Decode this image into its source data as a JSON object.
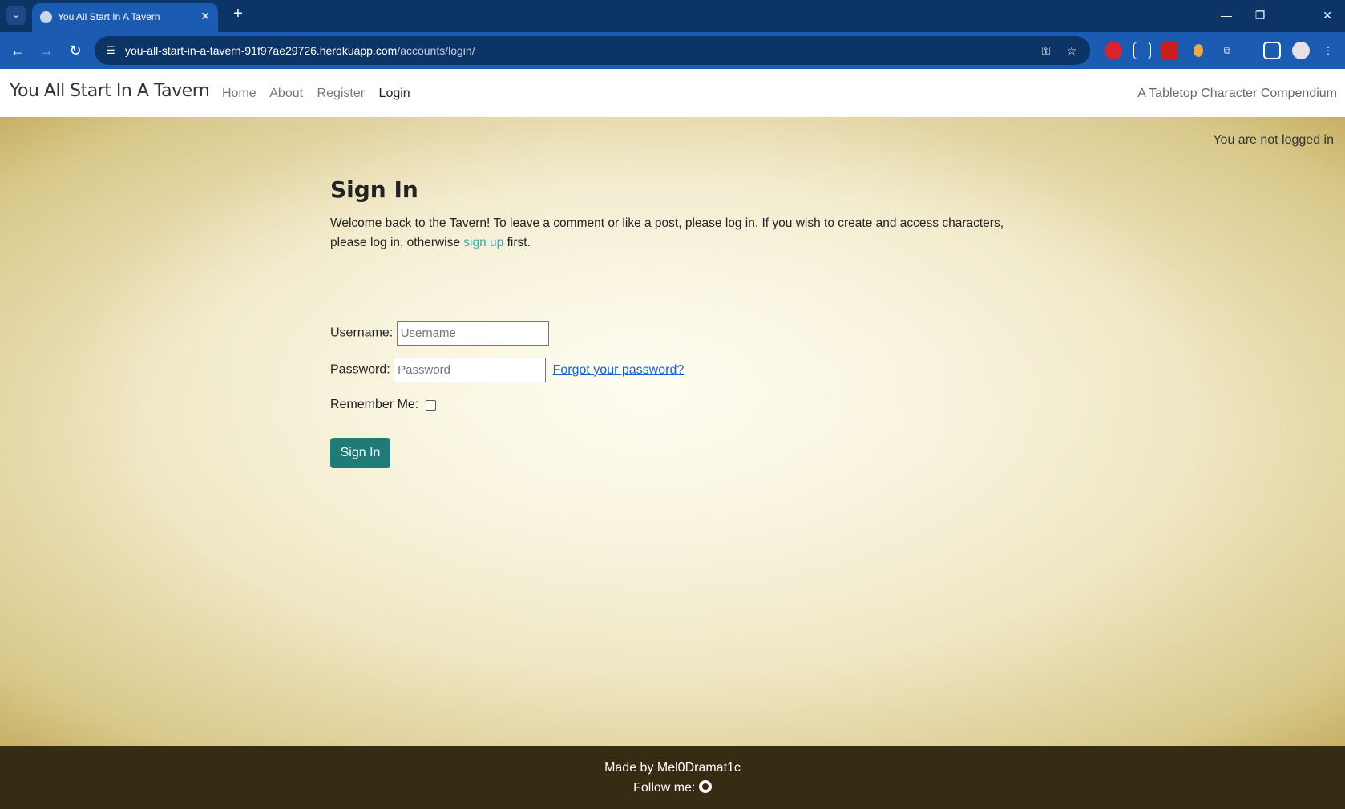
{
  "browser": {
    "tab_title": "You All Start In A Tavern",
    "tab_close": "✕",
    "new_tab": "+",
    "url_host": "you-all-start-in-a-tavern-91f97ae29726.herokuapp.com",
    "url_path": "/accounts/login/",
    "accent": "#1c5bb2",
    "frame": "#0d3466"
  },
  "navbar": {
    "brand": "You All Start In A Tavern",
    "links": [
      {
        "label": "Home"
      },
      {
        "label": "About"
      },
      {
        "label": "Register"
      },
      {
        "label": "Login"
      }
    ],
    "tagline": "A Tabletop Character Compendium"
  },
  "status": "You are not logged in",
  "login": {
    "title": "Sign In",
    "intro_before": "Welcome back to the Tavern! To leave a comment or like a post, please log in. If you wish to create and access characters, please log in, otherwise ",
    "intro_link": "sign up",
    "intro_after": " first.",
    "username_label": "Username:",
    "username_placeholder": "Username",
    "password_label": "Password:",
    "password_placeholder": "Password",
    "forgot_label": "Forgot your password?",
    "remember_label": "Remember Me:",
    "submit_label": "Sign In",
    "button_color": "#1f7a78"
  },
  "footer": {
    "made_by": "Made by Mel0Dramat1c",
    "follow": "Follow me:",
    "background": "#362b13"
  }
}
